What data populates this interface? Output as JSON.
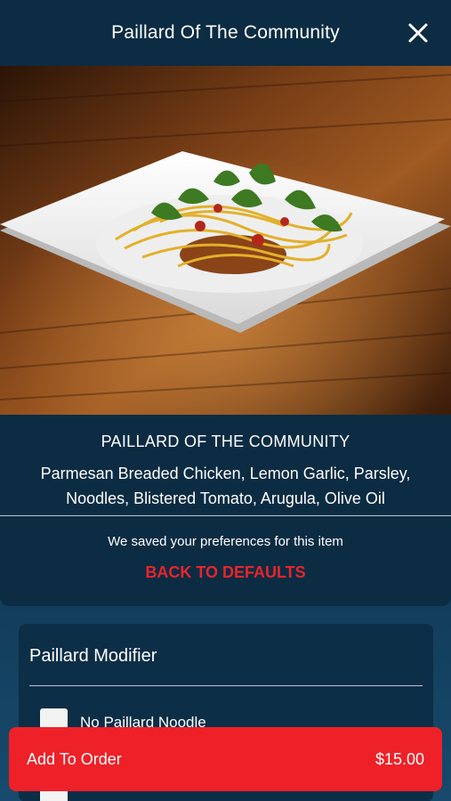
{
  "header": {
    "title": "Paillard Of The Community",
    "close_icon": "close-icon"
  },
  "hero_image": {
    "alt": "plate-of-pasta-icon"
  },
  "item": {
    "name": "PAILLARD OF THE COMMUNITY",
    "description": "Parmesan Breaded Chicken, Lemon Garlic, Parsley, Noodles, Blistered Tomato, Arugula, Olive Oil",
    "saved_message": "We saved your preferences for this item",
    "reset_label": "BACK TO DEFAULTS"
  },
  "modifier_group": {
    "heading": "Paillard Modifier",
    "options": [
      {
        "label": "No Paillard Noodle",
        "checked": false
      }
    ]
  },
  "footer": {
    "add_label": "Add To Order",
    "price": "$15.00"
  },
  "colors": {
    "background": "#0d2a40",
    "accent": "#ee2128",
    "reset_text": "#e8252b"
  }
}
